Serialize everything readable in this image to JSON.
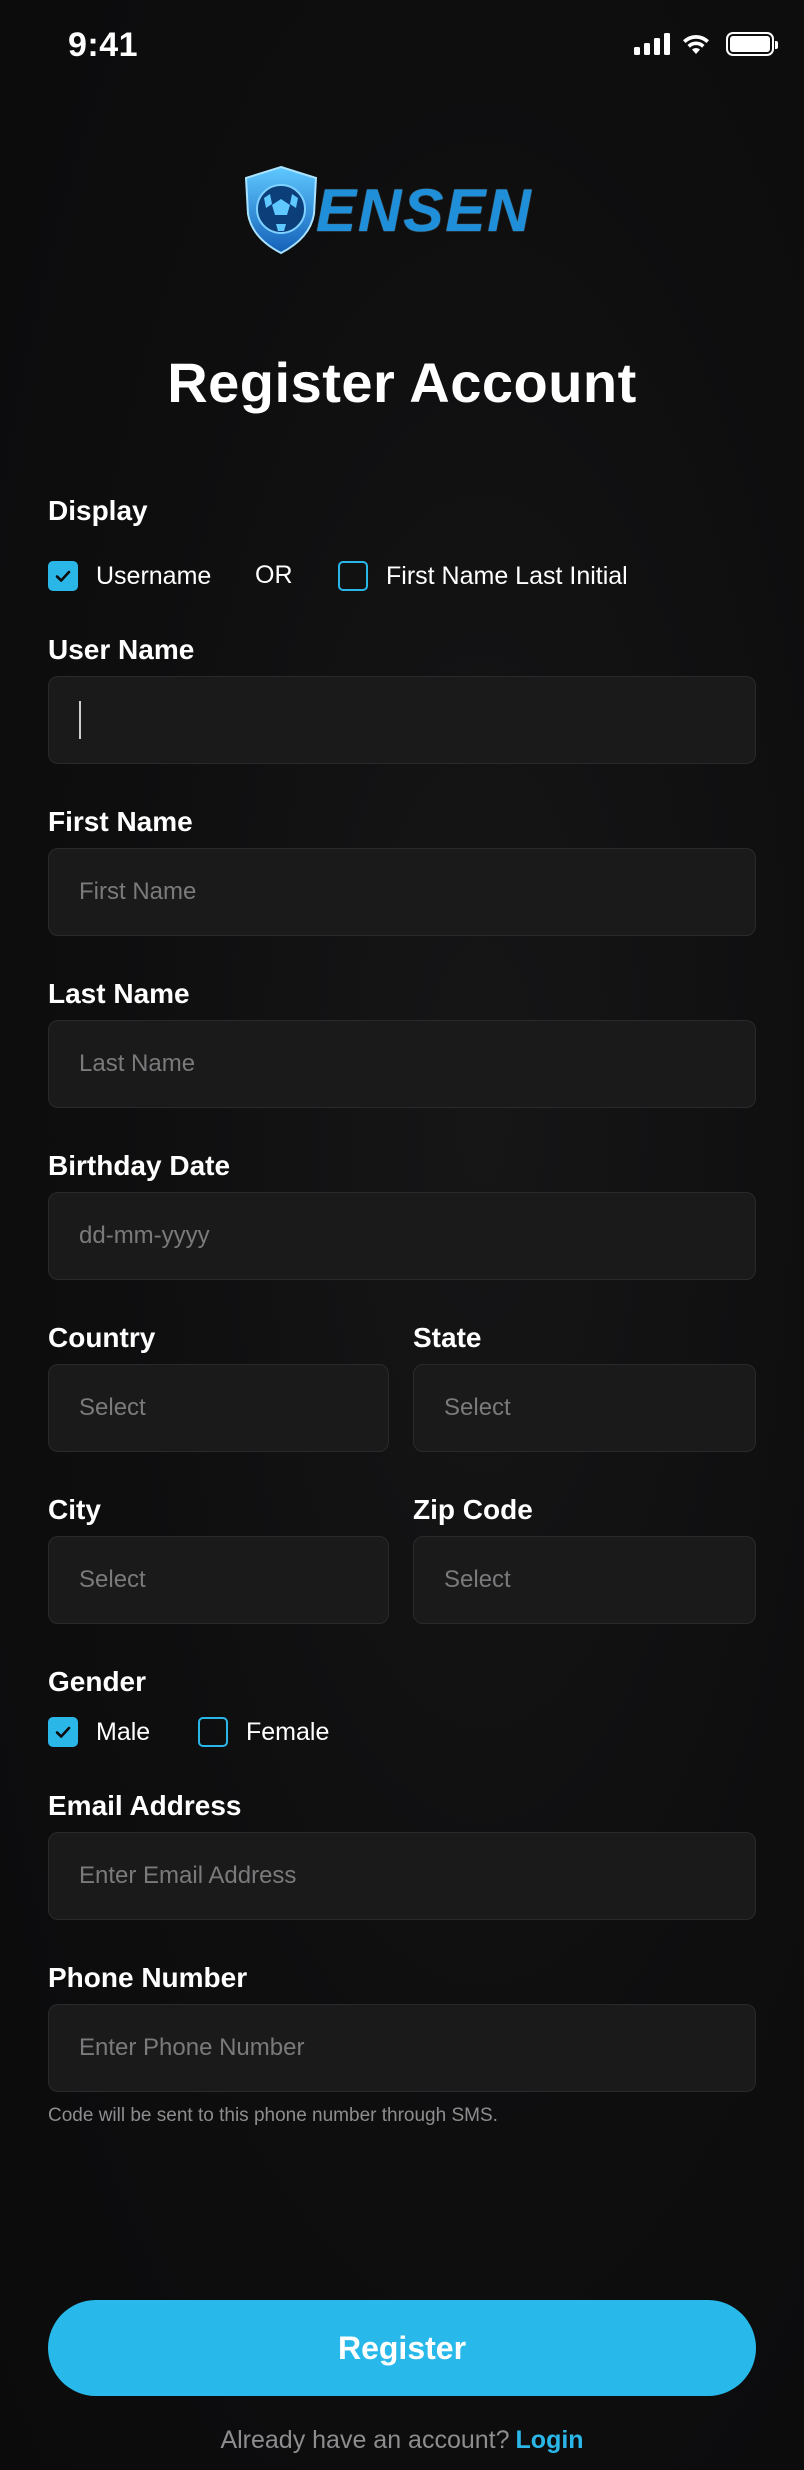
{
  "status_bar": {
    "time": "9:41"
  },
  "brand": {
    "name": "ENSEN"
  },
  "title": "Register Account",
  "display": {
    "label": "Display",
    "option_username": "Username",
    "or_text": "OR",
    "option_name": "First Name Last Initial",
    "username_checked": true,
    "name_checked": false
  },
  "fields": {
    "username": {
      "label": "User Name",
      "value": ""
    },
    "first_name": {
      "label": "First Name",
      "placeholder": "First Name"
    },
    "last_name": {
      "label": "Last Name",
      "placeholder": "Last Name"
    },
    "birthday": {
      "label": "Birthday Date",
      "placeholder": "dd-mm-yyyy"
    },
    "country": {
      "label": "Country",
      "placeholder": "Select"
    },
    "state": {
      "label": "State",
      "placeholder": "Select"
    },
    "city": {
      "label": "City",
      "placeholder": "Select"
    },
    "zip": {
      "label": "Zip Code",
      "placeholder": "Select"
    },
    "email": {
      "label": "Email Address",
      "placeholder": "Enter Email Address"
    },
    "phone": {
      "label": "Phone Number",
      "placeholder": "Enter Phone Number"
    }
  },
  "gender": {
    "label": "Gender",
    "option_male": "Male",
    "option_female": "Female",
    "male_checked": true,
    "female_checked": false
  },
  "phone_hint": "Code will be sent to this phone number through SMS.",
  "register_button": "Register",
  "login_prompt": "Already have an account?",
  "login_link": "Login",
  "colors": {
    "accent": "#2ab7e8",
    "background": "#0d0d0e",
    "field": "#1a1a1b"
  }
}
